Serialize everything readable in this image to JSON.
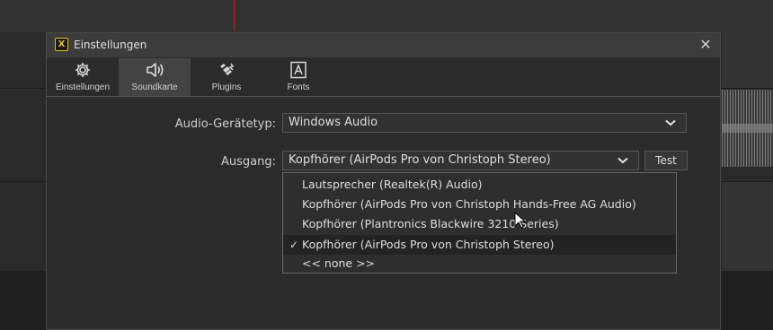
{
  "dialog": {
    "title": "Einstellungen",
    "app_icon_glyph": "X",
    "close_glyph": "✕"
  },
  "tabs": [
    {
      "label": "Einstellungen",
      "icon": "gear-icon"
    },
    {
      "label": "Soundkarte",
      "icon": "speaker-icon",
      "active": true
    },
    {
      "label": "Plugins",
      "icon": "plugin-icon"
    },
    {
      "label": "Fonts",
      "icon": "font-icon"
    }
  ],
  "form": {
    "device_type_label": "Audio-Gerätetyp:",
    "device_type_value": "Windows Audio",
    "output_label": "Ausgang:",
    "output_value": "Kopfhörer (AirPods Pro von Christoph Stereo)",
    "test_button": "Test"
  },
  "dropdown": {
    "options": [
      {
        "label": "Lautsprecher (Realtek(R) Audio)"
      },
      {
        "label": "Kopfhörer (AirPods Pro von Christoph Hands-Free AG Audio)"
      },
      {
        "label": "Kopfhörer (Plantronics Blackwire 3210 Series)"
      },
      {
        "label": "Kopfhörer (AirPods Pro von Christoph Stereo)",
        "selected": true,
        "check": "✓"
      },
      {
        "label": "<< none >>"
      }
    ]
  },
  "colors": {
    "accent": "#e8c020",
    "dialog_bg": "#2b2b2b",
    "playhead": "#c02020"
  }
}
